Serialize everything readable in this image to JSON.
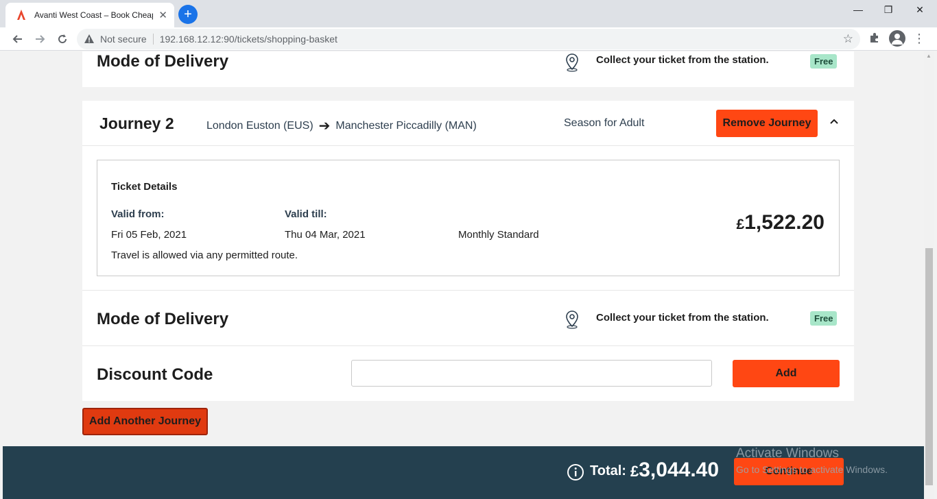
{
  "browser": {
    "tab_title": "Avanti West Coast – Book Cheap",
    "tab_close": "✕",
    "new_tab": "+",
    "minimize": "—",
    "restore": "❐",
    "close": "✕",
    "not_secure": "Not secure",
    "url": "192.168.12.12:90/tickets/shopping-basket"
  },
  "delivery_top": {
    "heading": "Mode of Delivery",
    "collect_text": "Collect your ticket from the station.",
    "badge": "Free"
  },
  "journey": {
    "title": "Journey 2",
    "origin": "London Euston (EUS)",
    "destination": "Manchester Piccadilly (MAN)",
    "ticket_type": "Season for Adult",
    "remove_label": "Remove Journey",
    "details": {
      "heading": "Ticket Details",
      "valid_from_label": "Valid from:",
      "valid_from_value": "Fri 05 Feb, 2021",
      "valid_till_label": "Valid till:",
      "valid_till_value": "Thu 04 Mar, 2021",
      "fare": "Monthly Standard",
      "route_note": "Travel is allowed via any permitted route.",
      "price_currency": "£",
      "price_amount": "1,522.20"
    }
  },
  "delivery_bottom": {
    "heading": "Mode of Delivery",
    "collect_text": "Collect your ticket from the station.",
    "badge": "Free"
  },
  "discount": {
    "heading": "Discount Code",
    "input_value": "",
    "add_label": "Add"
  },
  "add_journey_label": "Add Another Journey",
  "footer": {
    "total_label": "Total:",
    "total_currency": "£",
    "total_amount": "3,044.40",
    "continue_label": "Continue",
    "watermark_title": "Activate Windows",
    "watermark_sub": "Go to Settings to activate Windows."
  },
  "colors": {
    "accent": "#ff4713",
    "footer_bg": "#24404f",
    "badge_bg": "#a8e6c9"
  }
}
